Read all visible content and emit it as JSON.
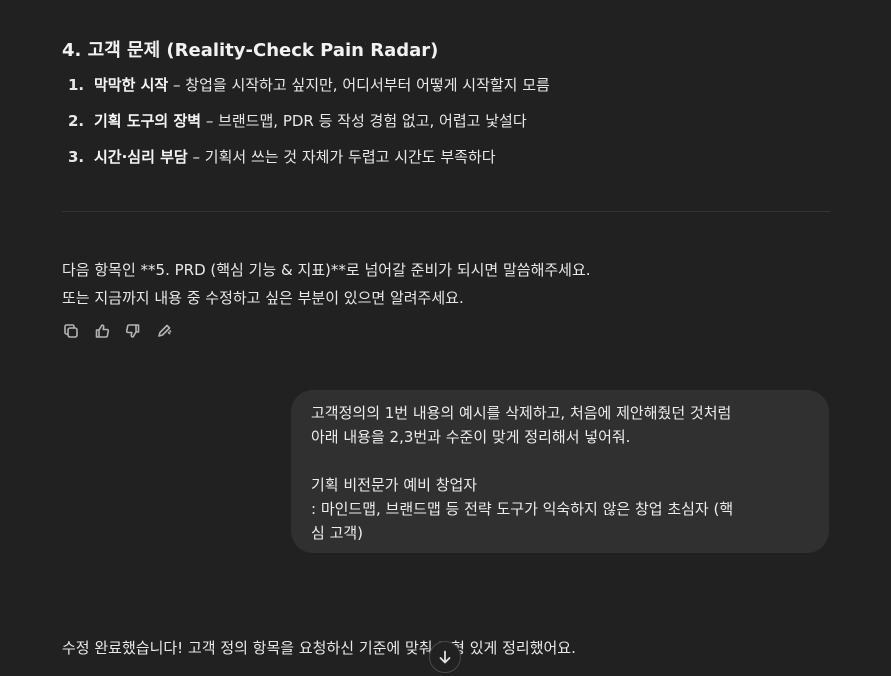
{
  "section": {
    "heading": "4. 고객 문제 (Reality-Check Pain Radar)",
    "items": [
      {
        "num": "1.",
        "title": "막막한 시작",
        "desc": " – 창업을 시작하고 싶지만, 어디서부터 어떻게 시작할지 모름"
      },
      {
        "num": "2.",
        "title": "기획 도구의 장벽",
        "desc": " – 브랜드맵, PDR 등 작성 경험 없고, 어렵고 낯설다"
      },
      {
        "num": "3.",
        "title": "시간·심리 부담",
        "desc": " – 기획서 쓰는 것 자체가 두렵고 시간도 부족하다"
      }
    ]
  },
  "assistant_message": {
    "line1": "다음 항목인 **5. PRD (핵심 기능 & 지표)**로 넘어갈 준비가 되시면 말씀해주세요.",
    "line2": "또는 지금까지 내용 중 수정하고 싶은 부분이 있으면 알려주세요."
  },
  "actions": {
    "icons": [
      "copy-icon",
      "thumbs-up-icon",
      "thumbs-down-icon",
      "edit-icon"
    ]
  },
  "user_message": {
    "line1": "고객정의의 1번 내용의 예시를 삭제하고, 처음에 제안해줬던 것처럼",
    "line2": "아래 내용을 2,3번과 수준이 맞게 정리해서 넣어줘.",
    "line3": "기획 비전문가 예비 창업자",
    "line4": ": 마인드맵, 브랜드맵 등 전략 도구가 익숙하지 않은 창업 초심자 (핵",
    "line5": "심 고객)"
  },
  "reply": {
    "text": "수정 완료했습니다! 고객 정의 항목을 요청하신 기준에 맞춰 균형 있게 정리했어요."
  }
}
